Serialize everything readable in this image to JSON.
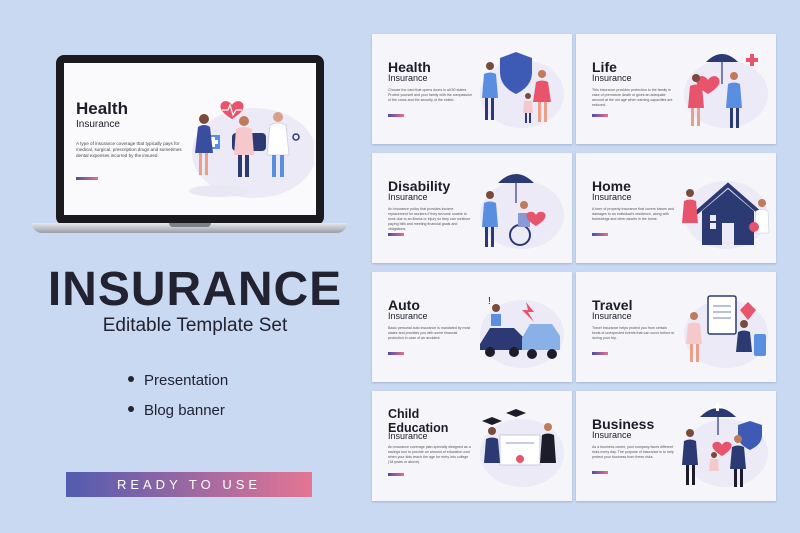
{
  "screen": {
    "title": "Health",
    "subtitle": "Insurance",
    "description": "A type of insurance coverage that typically pays for medical, surgical, prescription drugs and sometimes dental expenses incurred by the insured."
  },
  "hero": {
    "title": "INSURANCE",
    "subtitle": "Editable Template Set",
    "bullets": [
      "Presentation",
      "Blog banner"
    ],
    "cta": "READY TO USE"
  },
  "cards": [
    {
      "title": "Health",
      "subtitle": "Insurance",
      "desc": "Choose the card that opens doors in all 50 states. Protect yourself and your family with the compassion of the cross and the security of the shield.",
      "icon": "shield-family-icon"
    },
    {
      "title": "Life",
      "subtitle": "Insurance",
      "desc": "This insurance provides protection to the family in case of premature death or gives an adequate amount at the old age when earning capacities are reduced.",
      "icon": "umbrella-heart-icon"
    },
    {
      "title": "Disability",
      "subtitle": "Insurance",
      "desc": "An insurance policy that provides income replacement for workers if they become unable to work due to an illness or injury so they can continue paying bills and meeting financial goals and obligations.",
      "icon": "wheelchair-umbrella-icon"
    },
    {
      "title": "Home",
      "subtitle": "Insurance",
      "desc": "A form of property insurance that covers losses and damages to an individual's residence, along with furnishings and other assets in the home.",
      "icon": "house-icon"
    },
    {
      "title": "Auto",
      "subtitle": "Insurance",
      "desc": "Basic personal auto insurance is mandated by most states and provides you with some financial protection in case of an accident.",
      "icon": "car-crash-icon"
    },
    {
      "title": "Travel",
      "subtitle": "Insurance",
      "desc": "Travel insurance helps protect you from certain kinds of unexpected events that can occur before or during your trip.",
      "icon": "suitcase-clipboard-icon"
    },
    {
      "title": "Child Education",
      "subtitle": "Insurance",
      "desc": "An insurance coverage plan specially designed as a savings tool to provide an amount of education cost when your kids reach the age for entry into college (18 years or above).",
      "icon": "graduation-icon"
    },
    {
      "title": "Business",
      "subtitle": "Insurance",
      "desc": "As a business owner, your company faces different risks every day. The purpose of insurance is to help protect your business from these risks.",
      "icon": "business-umbrella-icon"
    }
  ],
  "colors": {
    "background": "#c9d9f2",
    "gradient_start": "#4a4fa6",
    "gradient_end": "#e86f8a",
    "navy": "#2c3a73",
    "pink": "#e8546c"
  }
}
